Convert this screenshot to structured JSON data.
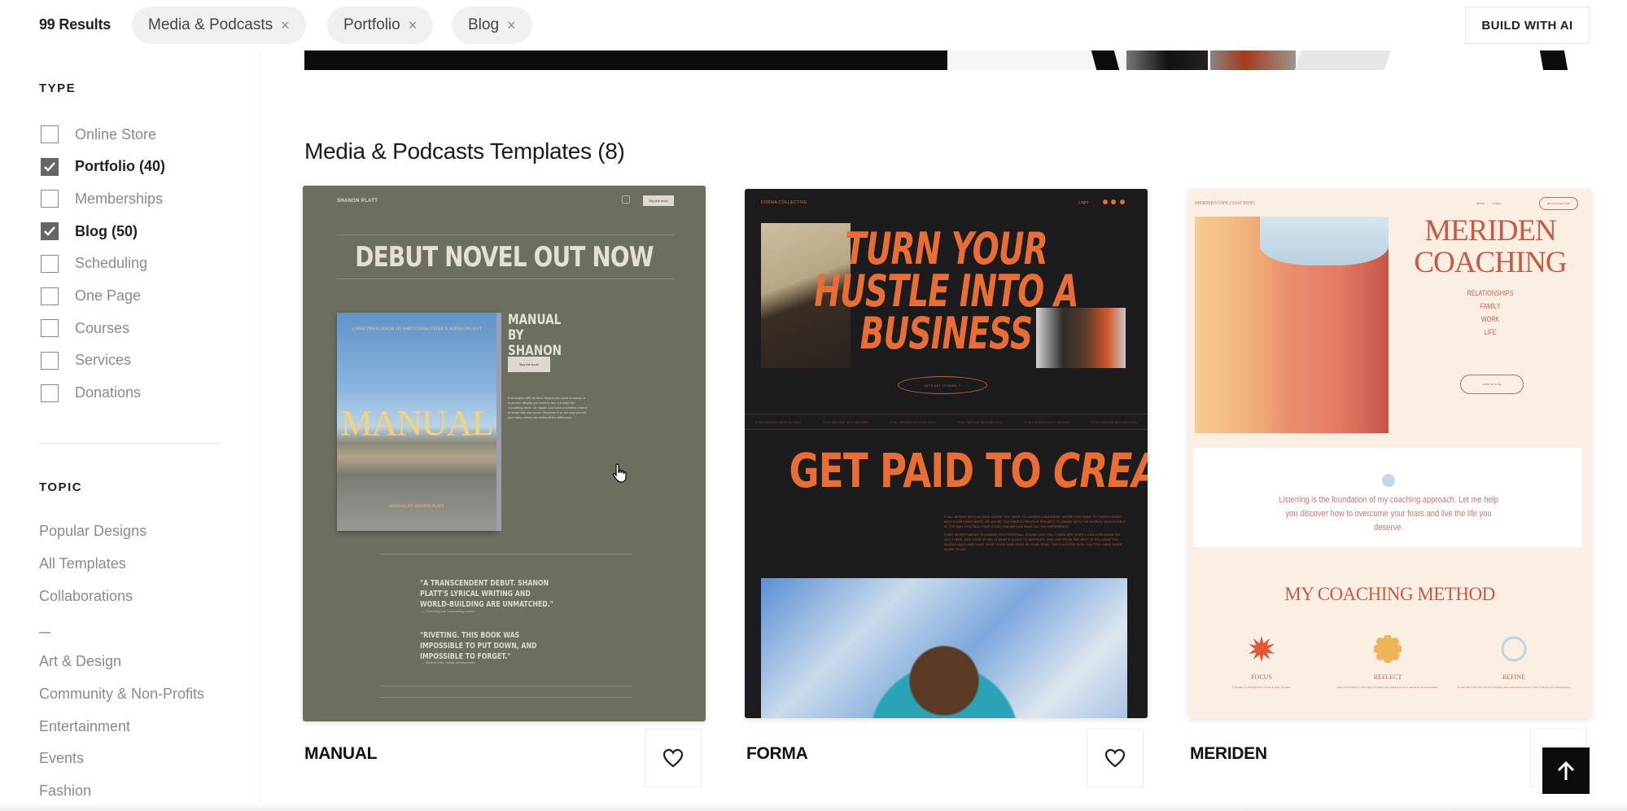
{
  "topbar": {
    "results": "99 Results",
    "filters": [
      {
        "label": "Media & Podcasts",
        "remove": "×"
      },
      {
        "label": "Portfolio",
        "remove": "×"
      },
      {
        "label": "Blog",
        "remove": "×"
      }
    ],
    "build_button": "BUILD WITH AI"
  },
  "sidebar": {
    "type_title": "TYPE",
    "types": [
      {
        "label": "Online Store",
        "checked": false
      },
      {
        "label": "Portfolio (40)",
        "checked": true
      },
      {
        "label": "Memberships",
        "checked": false
      },
      {
        "label": "Blog (50)",
        "checked": true
      },
      {
        "label": "Scheduling",
        "checked": false
      },
      {
        "label": "One Page",
        "checked": false
      },
      {
        "label": "Courses",
        "checked": false
      },
      {
        "label": "Services",
        "checked": false
      },
      {
        "label": "Donations",
        "checked": false
      }
    ],
    "topic_title": "TOPIC",
    "topics_primary": [
      "Popular Designs",
      "All Templates",
      "Collaborations"
    ],
    "topics_secondary": [
      "Art & Design",
      "Community & Non-Profits",
      "Entertainment",
      "Events",
      "Fashion"
    ]
  },
  "main": {
    "section_title": "Media & Podcasts Templates (8)",
    "templates": [
      {
        "name": "MANUAL",
        "preview": {
          "brand": "SHANON PLATT",
          "nav_button": "Buy the book",
          "headline": "DEBUT NOVEL OUT NOW",
          "book_title": "MANUAL",
          "book_subtitle": "LOREM IPSUM DOLOR SIT AMET CONSECTETUR & ADIPISCING ELIT",
          "book_author": "MANUAL BY SHANON PLATT",
          "subheading": "MANUAL BY SHANON PLATT",
          "cta": "Buy the book",
          "paragraph": "It all begins with an idea. Maybe you want to launch a business. Maybe you want to turn a hobby into something more. Or maybe you have a creative project to share with the world. Whatever it is, the way you tell your story online can make all the difference.",
          "quotes": [
            {
              "text": "\"A TRANSCENDENT DEBUT. SHANON PLATT'S LYRICAL WRITING AND WORLD-BUILDING ARE UNMATCHED.\"",
              "attribution": "— Channing Lee, best-selling author"
            },
            {
              "text": "\"RIVETING. THIS BOOK WAS IMPOSSIBLE TO PUT DOWN, AND IMPOSSIBLE TO FORGET.\"",
              "attribution": "— Benedi Ortiz, award-winning writer"
            }
          ]
        }
      },
      {
        "name": "FORMA",
        "preview": {
          "brand": "FORMA COLLECTIVE",
          "login": "Login",
          "headline": "TURN YOUR HUSTLE INTO A BUSINESS",
          "cta": "LET'S GET TO WORK ↗",
          "ticker": [
            "IT ALL BEGINS WITH AN IDEA",
            "IT ALL BEGINS WITH AN IDEA",
            "IT ALL BEGINS WITH AN IDEA",
            "IT ALL BEGINS WITH AN IDEA",
            "IT ALL BEGINS WITH AN IDEA",
            "IT ALL BEGINS WITH AN IDEA"
          ],
          "headline2_plain": "GET PAID TO",
          "headline2_italic": "CREATE",
          "paragraph1": "IT ALL BEGINS WITH AN IDEA. MAYBE YOU WANT TO LAUNCH A BUSINESS. MAYBE YOU WANT TO TURN A HOBBY INTO SOMETHING MORE. OR MAYBE YOU HAVE A CREATIVE PROJECT TO SHARE WITH THE WORLD. WHATEVER IT IS, THE WAY YOU TELL YOUR STORY ONLINE CAN MAKE ALL THE DIFFERENCE.",
          "paragraph2": "DON'T WORRY ABOUT SOUNDING PROFESSIONAL. SOUND LIKE YOU. THERE ARE OVER 1.5 BILLION WEBSITES OUT THERE, BUT YOUR STORY IS WHAT'S GOING TO SEPARATE THIS ONE FROM THE REST. IF YOU READ THE WORDS BACK AND DON'T HEAR YOUR OWN VOICE IN YOUR HEAD, THAT'S A GOOD SIGN YOU STILL HAVE MORE WORK TO DO."
        }
      },
      {
        "name": "MERIDEN",
        "preview": {
          "brand": "MERIDEN LIFE COACHING",
          "menu": "Menu",
          "login": "Login",
          "nav_button": "BE COACHED NOW",
          "headline": "MERIDEN COACHING",
          "areas": [
            "RELATIONSHIPS",
            "FAMILY",
            "WORK",
            "LIFE"
          ],
          "cta": "WORK WITH ME",
          "quote": "Listening is the foundation of my coaching approach. Let me help you discover how to overcome your fears and live the life you deserve.",
          "method_title": "MY COACHING METHOD",
          "steps": [
            {
              "name": "FOCUS",
              "desc": "It all starts by learning how to focus on what you want."
            },
            {
              "name": "REFLECT",
              "desc": "Next, you'll reflect on what may be blocking you, and learn how to overcome those obstacles."
            },
            {
              "name": "REFINE",
              "desc": "The last step? We learn how to continually refine what we've learned. Think of this as your new beginning."
            }
          ]
        }
      }
    ]
  },
  "icons": {
    "favorite": "heart-icon",
    "scroll_top": "arrow-up-icon",
    "remove_filter": "close-icon",
    "checkbox": "checkmark-icon"
  },
  "colors": {
    "manual_bg": "#6c6e5f",
    "forma_bg": "#1c1c1e",
    "forma_accent": "#ea6d35",
    "meriden_bg": "#fbeee2",
    "meriden_accent": "#c65b45",
    "chip_bg": "#f0f0f0",
    "checked_box": "#666666"
  }
}
